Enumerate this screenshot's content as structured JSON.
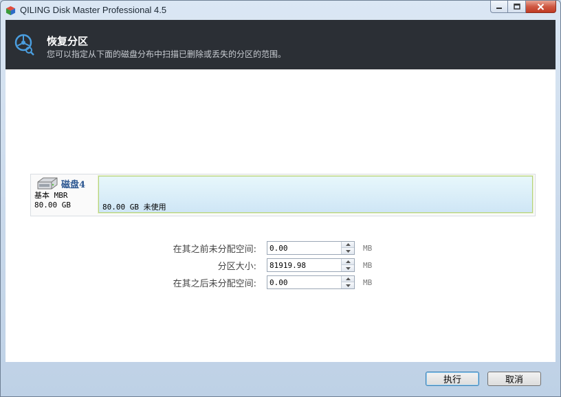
{
  "window": {
    "title": "QILING Disk Master Professional 4.5",
    "icon": "app-cube-icon",
    "controls": {
      "minimize": "minimize-icon",
      "maximize": "maximize-icon",
      "close": "close-icon"
    }
  },
  "header": {
    "icon": "recover-partition-icon",
    "title": "恢复分区",
    "subtitle": "您可以指定从下面的磁盘分布中扫描已删除或丢失的分区的范围。"
  },
  "disk": {
    "icon": "hard-disk-icon",
    "name": "磁盘4",
    "type": "基本 MBR",
    "size": "80.00 GB",
    "partition_label": "80.00 GB 未使用"
  },
  "form": {
    "before": {
      "label": "在其之前未分配空间:",
      "value": "0.00",
      "unit": "MB"
    },
    "size": {
      "label": "分区大小:",
      "value": "81919.98",
      "unit": "MB"
    },
    "after": {
      "label": "在其之后未分配空间:",
      "value": "0.00",
      "unit": "MB"
    }
  },
  "buttons": {
    "execute": "执行",
    "cancel": "取消"
  },
  "colors": {
    "header_bg": "#2b2f35",
    "accent": "#2a5590",
    "partition_border": "#b7d37a"
  }
}
